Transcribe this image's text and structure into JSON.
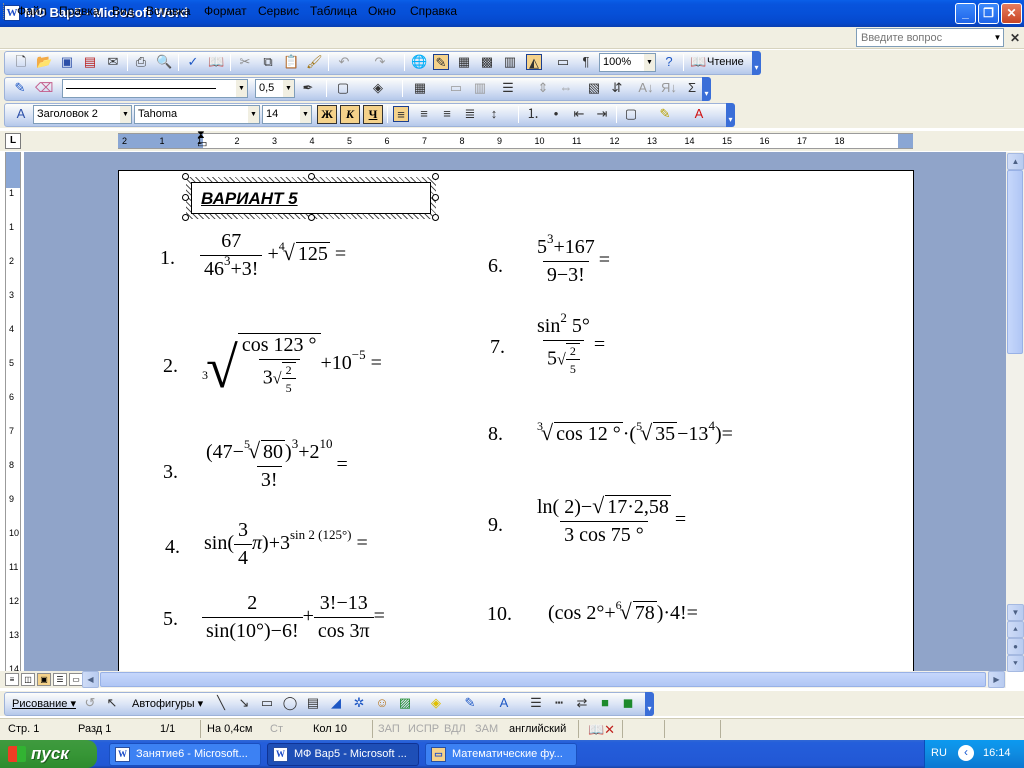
{
  "window": {
    "title": "МФ Вар5 - Microsoft Word",
    "icon": "W",
    "minimize": "_",
    "maximize": "❐",
    "close": "✕"
  },
  "menu": {
    "items": [
      "Файл",
      "Правка",
      "Вид",
      "Вставка",
      "Формат",
      "Сервис",
      "Таблица",
      "Окно",
      "Справка"
    ],
    "help_placeholder": "Введите вопрос"
  },
  "toolbar_standard": {
    "zoom": "100%",
    "reading_label": "Чтение"
  },
  "toolbar_tables": {
    "line_weight": "0,5"
  },
  "toolbar_formatting": {
    "style": "Заголовок 2",
    "font": "Tahoma",
    "size": "14",
    "bold": "Ж",
    "italic": "К",
    "underline": "Ч",
    "accent_color": "#f5d28a"
  },
  "ruler": {
    "marks": [
      "2",
      "1",
      "1",
      "2",
      "3",
      "4",
      "5",
      "6",
      "7",
      "8",
      "9",
      "10",
      "11",
      "12",
      "13",
      "14",
      "15",
      "16",
      "17",
      "18"
    ],
    "vmarks": [
      "1",
      "1",
      "2",
      "3",
      "4",
      "5",
      "6",
      "7",
      "8",
      "9",
      "10",
      "11",
      "12",
      "13",
      "14"
    ]
  },
  "document": {
    "heading": "ВАРИАНТ 5",
    "numbers": [
      "1.",
      "2.",
      "3.",
      "4.",
      "5.",
      "6.",
      "7.",
      "8.",
      "9.",
      "10."
    ],
    "p1": {
      "num": "67",
      "den_base": "46",
      "den_exp": "3",
      "den_rest": "+3!",
      "plus": "+",
      "root_idx": "4",
      "root_val": "125",
      "eq": "="
    },
    "p2": {
      "root_idx": "3",
      "num": "cos 123 °",
      "den_base": "3",
      "inner_idx": "",
      "inner_num": "2",
      "inner_den": "5",
      "rest": "+10",
      "rest_exp": "−5",
      "eq": "="
    },
    "p3": {
      "open": "(47−",
      "root_idx": "5",
      "root_val": "80",
      "close": ")",
      "exp1": "3",
      "plus2": "+2",
      "exp2": "10",
      "den": "3!",
      "eq": "="
    },
    "p4": {
      "pre": "sin(",
      "fnum": "3",
      "fden": "4",
      "pi": "π",
      "post": ")+3",
      "exp": "sin 2 (125°)",
      "eq": "="
    },
    "p5": {
      "num1": "2",
      "den1": "sin(10°)−6!",
      "plus": "+",
      "num2": "3!−13",
      "den2": "cos 3π",
      "eq": "="
    },
    "p6": {
      "num_base": "5",
      "num_exp": "3",
      "num_rest": "+167",
      "den": "9−3!",
      "eq": "="
    },
    "p7": {
      "num": "sin",
      "num_exp": "2",
      "num_rest": "5°",
      "den_base": "5",
      "inner_num": "2",
      "inner_den": "5",
      "eq": "="
    },
    "p8": {
      "root_idx": "3",
      "root_val": "cos 12 °",
      "mid": "·(",
      "root2_idx": "5",
      "root2_val": "35",
      "rest": "−13",
      "rest_exp": "4",
      "close": ")="
    },
    "p9": {
      "num_pre": "ln( 2)−",
      "root_val": "17·2,58",
      "den": "3 cos  75 °",
      "eq": "="
    },
    "p10": {
      "pre": "(cos  2°+",
      "root_idx": "6",
      "root_val": "78",
      "post": ")·4!="
    }
  },
  "draw_toolbar": {
    "drawing_label": "Рисование ▾",
    "autoshapes_label": "Автофигуры ▾"
  },
  "status": {
    "page": "Стр.  1",
    "section": "Разд  1",
    "pages": "1/1",
    "at": "На 0,4см",
    "ln": "Ст",
    "col": "Кол  10",
    "rec": "ЗАП",
    "trk": "ИСПР",
    "ext": "ВДЛ",
    "ovr": "ЗАМ",
    "language": "английский"
  },
  "taskbar": {
    "start_label": "пуск",
    "tasks": [
      "Занятие6 - Microsoft...",
      "МФ Вар5 - Microsoft ...",
      "Математические фу..."
    ],
    "lang": "RU",
    "time": "16:14"
  }
}
